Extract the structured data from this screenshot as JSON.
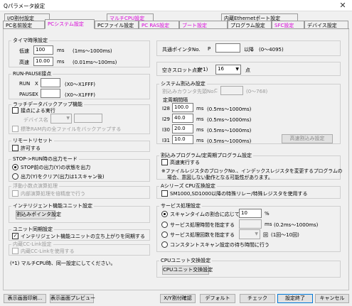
{
  "window": {
    "title": "Qパラメータ設定",
    "close_glyph": "✕"
  },
  "tabs_row1": [
    {
      "label": "I/O割付設定",
      "pink": false
    },
    {
      "label": "マルチCPU設定",
      "pink": true
    },
    {
      "label": "内蔵Ethernetポート設定",
      "pink": false
    }
  ],
  "tabs_row2": [
    {
      "label": "PC名前設定",
      "pink": false
    },
    {
      "label": "PCシステム設定",
      "pink": true
    },
    {
      "label": "PCファイル設定",
      "pink": false
    },
    {
      "label": "PC RAS設定",
      "pink": true
    },
    {
      "label": "ブート設定",
      "pink": true
    },
    {
      "label": "プログラム設定",
      "pink": false
    },
    {
      "label": "SFC設定",
      "pink": true
    },
    {
      "label": "デバイス設定",
      "pink": false
    }
  ],
  "timer": {
    "title": "タイマ時限設定",
    "low_label": "低速",
    "low_value": "100",
    "low_unit": "ms",
    "low_range": "(1ms～1000ms)",
    "high_label": "高速",
    "high_value": "10.00",
    "high_unit": "ms",
    "high_range": "(0.01ms～100ms)"
  },
  "run_pause": {
    "title": "RUN-PAUSE接点",
    "run_label": "RUN",
    "pause_label": "PAUSE",
    "x_label": "X",
    "x_range": "(X0～X1FFF)"
  },
  "latch": {
    "title": "ラッチデータバックアップ機能",
    "exec_label": "接点による実行",
    "device_label": "デバイス名",
    "backup_label": "標準RAM内の全ファイルをバックアップする"
  },
  "remote_reset": {
    "title": "リモートリセット",
    "allow_label": "許可する"
  },
  "stop_run": {
    "title": "STOP->RUN時の出力モード",
    "opt1": "STOP前の出力(Y)の状態を出力",
    "opt2": "出力(Y)をクリア(出力は1スキャン後)"
  },
  "float_calc": {
    "title": "浮動小数点演算処理",
    "opt": "内部演算処理を倍精度で行う"
  },
  "intelligent": {
    "title": "インテリジェント機能ユニット設定",
    "btn": "割込みポインタ設定"
  },
  "module_sync": {
    "title": "ユニット同期設定",
    "opt": "インテリジェント機能ユニットの立ち上がりを同期する"
  },
  "cclink": {
    "title": "内蔵CC-Link設定",
    "opt": "内蔵CC-Linkを使用する"
  },
  "footnote": "(*1) マルチCPU時、同一設定にしてください。",
  "common_pointer": {
    "label": "共通ポインタNo.",
    "p": "P",
    "value": "",
    "suffix": "以降",
    "range": "(0～4095)"
  },
  "empty_slot": {
    "label": "空きスロット点数",
    "note": "(*1)",
    "value": "16",
    "unit": "点"
  },
  "sys_interrupt": {
    "title": "システム割込み設定",
    "counter_label": "割込みカウンタ先頭No.",
    "c": "C",
    "counter_range": "(0～768)",
    "fixed_title": "定周期間隔",
    "rows": [
      {
        "name": "I28",
        "value": "100.0",
        "unit": "ms",
        "range": "(0.5ms～1000ms)"
      },
      {
        "name": "I29",
        "value": "40.0",
        "unit": "ms",
        "range": "(0.5ms～1000ms)"
      },
      {
        "name": "I30",
        "value": "20.0",
        "unit": "ms",
        "range": "(0.5ms～1000ms)"
      },
      {
        "name": "I31",
        "value": "10.0",
        "unit": "ms",
        "range": "(0.5ms～1000ms)"
      }
    ],
    "fast_btn": "高速割込み設定"
  },
  "interrupt_prog": {
    "title": "割込みプログラム/定周期プログラム設定",
    "opt": "高速実行する",
    "note1": "※ファイルレジスタのブロックNo.、インデックスレジスタを変更するプログラムの",
    "note2": "場合、意図しない動作となる可能性があります。"
  },
  "a_series": {
    "title": "Aシリーズ CPU互換設定",
    "opt": "SM1000,SD1000以降の特殊リレー/特殊レジスタを使用する"
  },
  "service": {
    "title": "サービス処理設定",
    "opt1": "スキャンタイムの割合に応じて行う",
    "opt1_value": "10",
    "opt1_unit": "%",
    "opt2": "サービス処理時間を指定する",
    "opt2_unit": "ms",
    "opt2_range": "(0.2ms～1000ms)",
    "opt3": "サービス処理回数を指定する",
    "opt3_unit": "回",
    "opt3_range": "(1回～10回)",
    "opt4": "コンスタントスキャン設定の待ち時間に行う"
  },
  "cpu_module_change": {
    "title": "CPUユニット交換設定",
    "btn": "CPUユニット交換設定"
  },
  "bottom": {
    "print_btn": "表示画面印刷...",
    "preview_btn": "表示画面プレビュー",
    "xy_btn": "X/Y割付確認",
    "default_btn": "デフォルト",
    "check_btn": "チェック",
    "finish_btn": "設定終了",
    "cancel_btn": "キャンセル"
  }
}
